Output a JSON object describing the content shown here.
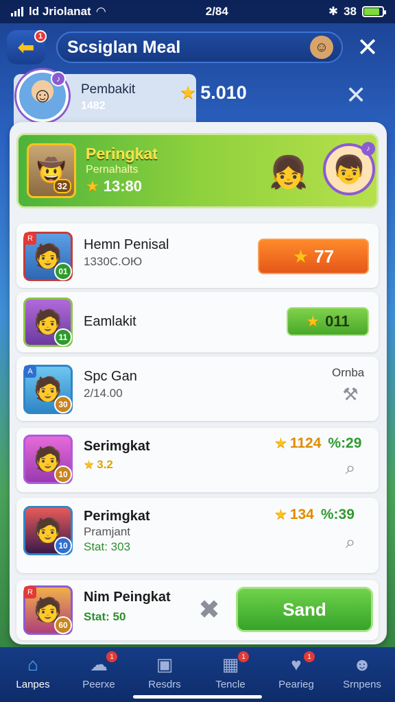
{
  "status_bar": {
    "carrier": "ld Jriolanat",
    "time": "2/84",
    "right_text": "38",
    "battery_level": 0.85
  },
  "header": {
    "back_badge": "1",
    "title": "Scsiglan Meal"
  },
  "profile": {
    "name": "Pembakit",
    "sub": "1482",
    "coins": "5.010"
  },
  "featured": {
    "title": "Peringkat",
    "subtitle": "Pernahalts",
    "score": "13:80",
    "rank": "32"
  },
  "rows": [
    {
      "name": "Hemn Penisal",
      "sub": "1330С.ОЮ",
      "button_value": "77",
      "level": "01",
      "tag": "R"
    },
    {
      "name": "Eamlakit",
      "button_value": "011",
      "level": "11"
    },
    {
      "name": "Spc Gan",
      "sub": "2/14.00",
      "right_label": "Ornba",
      "level": "30",
      "tag": "A"
    },
    {
      "name": "Serimgkat",
      "sub": "3.2",
      "score": "1124",
      "ratio": "%:29",
      "level": "10"
    },
    {
      "name": "Perimgkat",
      "sub": "Pramjant",
      "sub2": "Stat: 303",
      "score": "134",
      "ratio": "%:39",
      "level": "10"
    },
    {
      "name": "Nim Peingkat",
      "sub": "Stat: 50",
      "level": "60",
      "tag": "R"
    }
  ],
  "send_label": "Sand",
  "nav": [
    {
      "label": "Lanpes",
      "icon": "home-icon",
      "active": true
    },
    {
      "label": "Peerxe",
      "icon": "chat-icon",
      "badge": "1"
    },
    {
      "label": "Resdrs",
      "icon": "box-icon"
    },
    {
      "label": "Tencle",
      "icon": "calendar-icon",
      "badge": "1"
    },
    {
      "label": "Pearieg",
      "icon": "heart-icon",
      "badge": "1"
    },
    {
      "label": "Srnpens",
      "icon": "users-icon"
    }
  ],
  "colors": {
    "accent_gold": "#ffc21a",
    "button_orange": "#e5571a",
    "button_green": "#49a82a",
    "nav_bg": "#163c86"
  }
}
